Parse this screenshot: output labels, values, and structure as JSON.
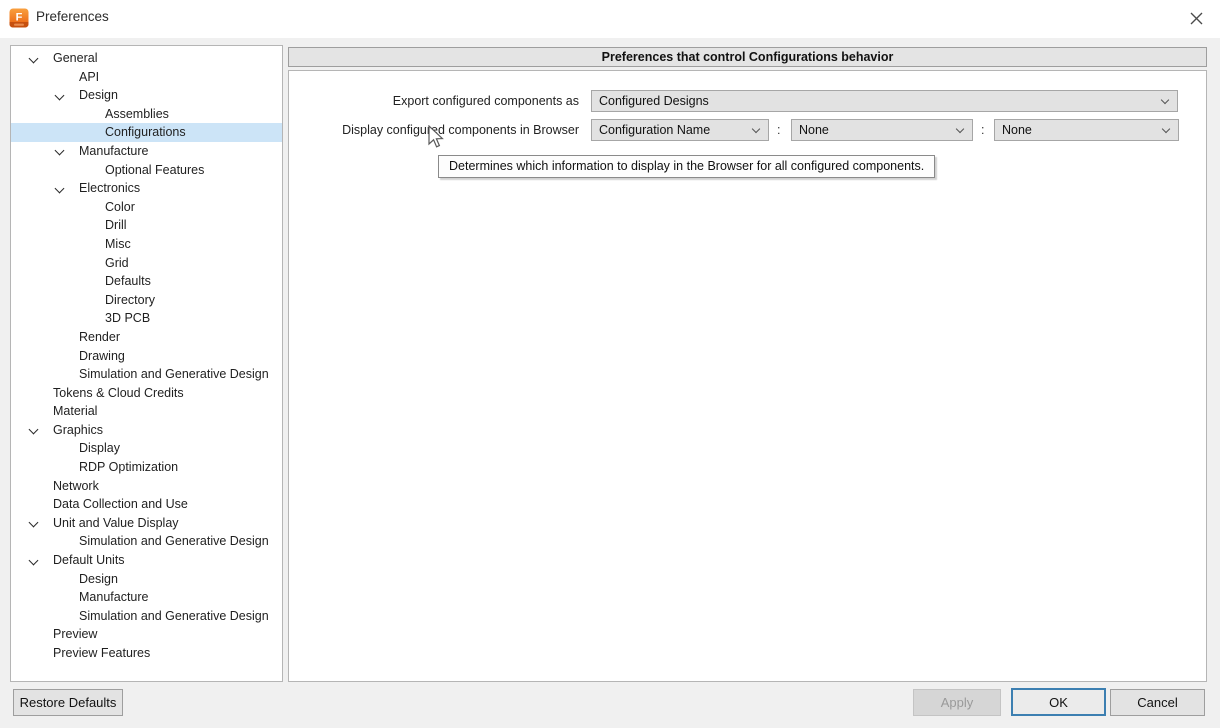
{
  "window": {
    "title": "Preferences",
    "close_icon": "x-close",
    "app_icon": "fusion-logo"
  },
  "colors": {
    "selection_highlight": "#cce4f7",
    "ok_focus_border": "#3c7fb1",
    "logo_orange_top": "#f9a03f",
    "logo_orange_bottom": "#e95d0c",
    "logo_band": "#c6500f",
    "panel_border": "#b5b5b5",
    "dropdown_bg": "#e2e2e2"
  },
  "sidebar": {
    "items": [
      {
        "label": "General",
        "level": 0,
        "expandable": true,
        "selected": false
      },
      {
        "label": "API",
        "level": 1,
        "expandable": false,
        "selected": false
      },
      {
        "label": "Design",
        "level": 1,
        "expandable": true,
        "selected": false
      },
      {
        "label": "Assemblies",
        "level": 2,
        "expandable": false,
        "selected": false
      },
      {
        "label": "Configurations",
        "level": 2,
        "expandable": false,
        "selected": true
      },
      {
        "label": "Manufacture",
        "level": 1,
        "expandable": true,
        "selected": false
      },
      {
        "label": "Optional Features",
        "level": 2,
        "expandable": false,
        "selected": false
      },
      {
        "label": "Electronics",
        "level": 1,
        "expandable": true,
        "selected": false
      },
      {
        "label": "Color",
        "level": 2,
        "expandable": false,
        "selected": false
      },
      {
        "label": "Drill",
        "level": 2,
        "expandable": false,
        "selected": false
      },
      {
        "label": "Misc",
        "level": 2,
        "expandable": false,
        "selected": false
      },
      {
        "label": "Grid",
        "level": 2,
        "expandable": false,
        "selected": false
      },
      {
        "label": "Defaults",
        "level": 2,
        "expandable": false,
        "selected": false
      },
      {
        "label": "Directory",
        "level": 2,
        "expandable": false,
        "selected": false
      },
      {
        "label": "3D PCB",
        "level": 2,
        "expandable": false,
        "selected": false
      },
      {
        "label": "Render",
        "level": 1,
        "expandable": false,
        "selected": false
      },
      {
        "label": "Drawing",
        "level": 1,
        "expandable": false,
        "selected": false
      },
      {
        "label": "Simulation and Generative Design",
        "level": 1,
        "expandable": false,
        "selected": false
      },
      {
        "label": "Tokens & Cloud Credits",
        "level": 0,
        "expandable": false,
        "selected": false
      },
      {
        "label": "Material",
        "level": 0,
        "expandable": false,
        "selected": false
      },
      {
        "label": "Graphics",
        "level": 0,
        "expandable": true,
        "selected": false
      },
      {
        "label": "Display",
        "level": 1,
        "expandable": false,
        "selected": false
      },
      {
        "label": "RDP Optimization",
        "level": 1,
        "expandable": false,
        "selected": false
      },
      {
        "label": "Network",
        "level": 0,
        "expandable": false,
        "selected": false
      },
      {
        "label": "Data Collection and Use",
        "level": 0,
        "expandable": false,
        "selected": false
      },
      {
        "label": "Unit and Value Display",
        "level": 0,
        "expandable": true,
        "selected": false
      },
      {
        "label": "Simulation and Generative Design",
        "level": 1,
        "expandable": false,
        "selected": false
      },
      {
        "label": "Default Units",
        "level": 0,
        "expandable": true,
        "selected": false
      },
      {
        "label": "Design",
        "level": 1,
        "expandable": false,
        "selected": false
      },
      {
        "label": "Manufacture",
        "level": 1,
        "expandable": false,
        "selected": false
      },
      {
        "label": "Simulation and Generative Design",
        "level": 1,
        "expandable": false,
        "selected": false
      },
      {
        "label": "Preview",
        "level": 0,
        "expandable": false,
        "selected": false
      },
      {
        "label": "Preview Features",
        "level": 0,
        "expandable": false,
        "selected": false
      }
    ]
  },
  "main": {
    "header": "Preferences that control Configurations behavior",
    "rows": [
      {
        "label": "Export configured components as",
        "dropdowns": [
          "Configured Designs"
        ]
      },
      {
        "label": "Display configured components in Browser",
        "separator": ":",
        "dropdowns": [
          "Configuration Name",
          "None",
          "None"
        ]
      }
    ],
    "tooltip": "Determines which information to display in the Browser for all configured components."
  },
  "footer": {
    "restore_defaults": "Restore Defaults",
    "apply": "Apply",
    "ok": "OK",
    "cancel": "Cancel"
  }
}
